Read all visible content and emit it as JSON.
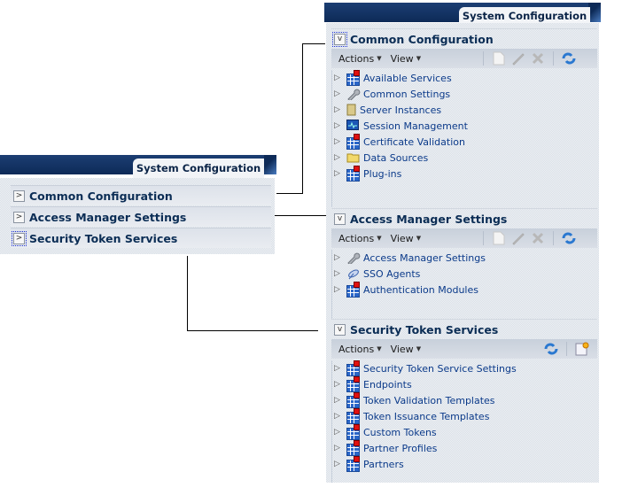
{
  "left_panel": {
    "tab_title": "System Configuration",
    "sections": [
      {
        "label": "Common Configuration",
        "toggle": ">"
      },
      {
        "label": "Access Manager Settings",
        "toggle": ">"
      },
      {
        "label": "Security Token Services",
        "toggle": ">"
      }
    ]
  },
  "right_panel": {
    "tab_title": "System Configuration",
    "sections": [
      {
        "label": "Common Configuration",
        "toggle": "v",
        "toolbar": {
          "actions": "Actions",
          "view": "View",
          "icons": [
            "new-icon",
            "edit-icon",
            "delete-icon",
            "refresh-icon"
          ]
        },
        "items": [
          {
            "label": "Available Services",
            "icon": "grid-icon"
          },
          {
            "label": "Common Settings",
            "icon": "wrench-icon"
          },
          {
            "label": "Server Instances",
            "icon": "server-icon"
          },
          {
            "label": "Session Management",
            "icon": "monitor-icon"
          },
          {
            "label": "Certificate Validation",
            "icon": "grid-icon"
          },
          {
            "label": "Data Sources",
            "icon": "folder-icon"
          },
          {
            "label": "Plug-ins",
            "icon": "grid-icon"
          }
        ]
      },
      {
        "label": "Access Manager Settings",
        "toggle": "v",
        "toolbar": {
          "actions": "Actions",
          "view": "View",
          "icons": [
            "new-icon",
            "edit-icon",
            "delete-icon",
            "refresh-icon"
          ]
        },
        "items": [
          {
            "label": "Access Manager Settings",
            "icon": "wrench-icon"
          },
          {
            "label": "SSO Agents",
            "icon": "satellite-icon"
          },
          {
            "label": "Authentication Modules",
            "icon": "grid-icon"
          }
        ]
      },
      {
        "label": "Security Token Services",
        "toggle": "v",
        "toolbar": {
          "actions": "Actions",
          "view": "View",
          "icons": [
            "refresh-icon",
            "create-icon"
          ]
        },
        "items": [
          {
            "label": "Security Token Service Settings",
            "icon": "grid-icon"
          },
          {
            "label": "Endpoints",
            "icon": "grid-icon"
          },
          {
            "label": "Token Validation Templates",
            "icon": "grid-icon"
          },
          {
            "label": "Token Issuance Templates",
            "icon": "grid-icon"
          },
          {
            "label": "Custom Tokens",
            "icon": "grid-icon"
          },
          {
            "label": "Partner Profiles",
            "icon": "grid-icon"
          },
          {
            "label": "Partners",
            "icon": "grid-icon"
          }
        ]
      }
    ]
  }
}
